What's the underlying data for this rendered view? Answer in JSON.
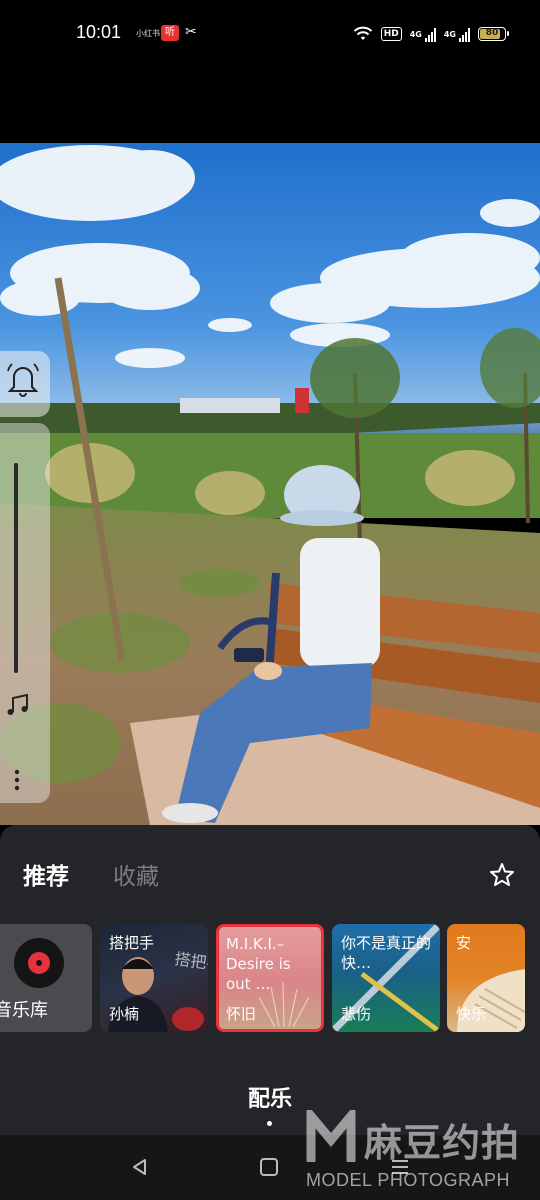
{
  "status_bar": {
    "time": "10:01",
    "app_icons": [
      "小红书",
      "听",
      "capcut-icon"
    ],
    "hd_label": "HD",
    "network_a": "4G",
    "network_b": "4G",
    "battery_level": "80"
  },
  "side_controls": {
    "icons": [
      "bell-icon",
      "music-note-icon",
      "more-dots-icon"
    ]
  },
  "music_sheet": {
    "tabs": [
      "推荐",
      "收藏"
    ],
    "favorite_icon": "star-icon",
    "library_label": "音乐库",
    "cards": [
      {
        "title": "搭把手",
        "tag": "孙楠",
        "art_text": "搭把手"
      },
      {
        "title": "M.I.K.I.–Desire is out …",
        "tag": "怀旧",
        "selected": true
      },
      {
        "title": "你不是真正的快…",
        "tag": "悲伤"
      },
      {
        "title": "安",
        "tag": "快乐"
      }
    ],
    "action_label": "配乐"
  },
  "nav_bar": {
    "icons": [
      "back-triangle-icon",
      "home-square-icon",
      "menu-lines-icon"
    ]
  },
  "watermark": {
    "brand_cn": "麻豆约拍",
    "brand_en": "MODEL PHOTOGRAPH"
  },
  "colors": {
    "sheet_bg": "#242528",
    "accent_red": "#e8323e",
    "battery_fill": "#c8b04a"
  }
}
